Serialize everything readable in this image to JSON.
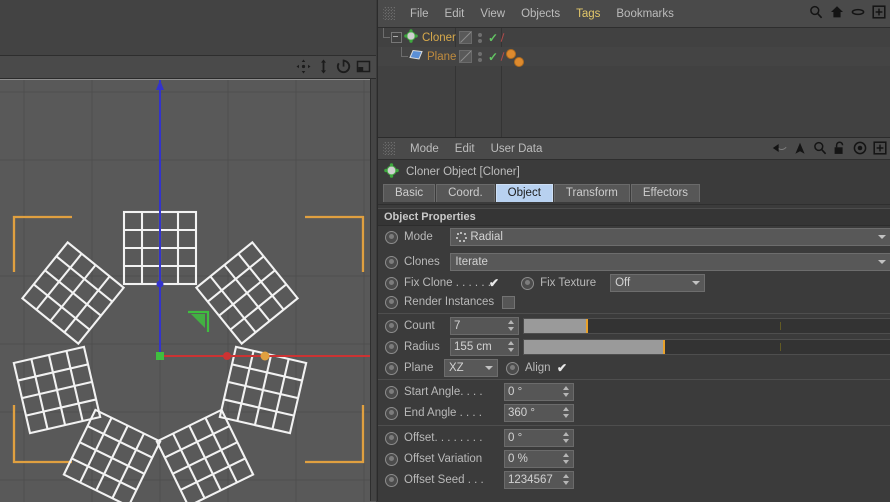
{
  "object_manager": {
    "menu": [
      {
        "label": "File",
        "highlight": false
      },
      {
        "label": "Edit",
        "highlight": false
      },
      {
        "label": "View",
        "highlight": false
      },
      {
        "label": "Objects",
        "highlight": false
      },
      {
        "label": "Tags",
        "highlight": true
      },
      {
        "label": "Bookmarks",
        "highlight": false
      }
    ],
    "icons": [
      "search-icon",
      "home-icon",
      "ellipse-icon",
      "add-box-icon"
    ],
    "tree": [
      {
        "name": "Cloner",
        "type": "cloner",
        "indent": 0,
        "tags": 0
      },
      {
        "name": "Plane",
        "type": "plane",
        "indent": 1,
        "tags": 2
      }
    ]
  },
  "attribute_manager": {
    "menu": [
      {
        "label": "Mode"
      },
      {
        "label": "Edit"
      },
      {
        "label": "User Data"
      }
    ],
    "icons": [
      "back-arrow-icon",
      "up-arrow-icon",
      "search-icon",
      "unlock-icon",
      "target-icon",
      "add-box-icon"
    ],
    "title": "Cloner Object [Cloner]",
    "tabs": [
      {
        "label": "Basic",
        "active": false
      },
      {
        "label": "Coord.",
        "active": false
      },
      {
        "label": "Object",
        "active": true
      },
      {
        "label": "Transform",
        "active": false
      },
      {
        "label": "Effectors",
        "active": false
      }
    ],
    "section_title": "Object Properties",
    "fields": {
      "mode_label": "Mode",
      "mode_value": "Radial",
      "clones_label": "Clones",
      "clones_value": "Iterate",
      "fix_clone_label": "Fix Clone . . . . . .",
      "fix_clone_checked": "✔",
      "fix_texture_label": "Fix Texture",
      "fix_texture_value": "Off",
      "render_instances_label": "Render Instances",
      "count_label": "Count",
      "count_value": "7",
      "count_fill_pct": 17,
      "radius_label": "Radius",
      "radius_value": "155 cm",
      "radius_fill_pct": 38,
      "plane_label": "Plane",
      "plane_value": "XZ",
      "align_label": "Align",
      "align_checked": "✔",
      "start_angle_label": "Start Angle. . . .",
      "start_angle_value": "0 °",
      "end_angle_label": "End Angle . . . .",
      "end_angle_value": "360 °",
      "offset_label": "Offset. . . . . . . .",
      "offset_value": "0 °",
      "offset_variation_label": "Offset Variation",
      "offset_variation_value": "0 %",
      "offset_seed_label": "Offset Seed . . .",
      "offset_seed_value": "1234567"
    }
  },
  "viewport": {
    "tools": [
      "move-camera-icon",
      "dolly-camera-icon",
      "rotate-camera-icon",
      "maximize-view-icon"
    ],
    "scene": {
      "clone_count": 7,
      "grid_subdivisions": 4,
      "axis_x_color": "#cc3333",
      "axis_y_color": "#3333cc",
      "origin_color": "#3fbf3f",
      "selection_bracket_color": "#e0a040",
      "wireframe_color": "#f2f2f2",
      "background_color": "#595959"
    }
  },
  "colors": {
    "accent": "#e8a12a",
    "tab_active": "#b8d1f0",
    "menu_highlight": "#e3c86a",
    "panel": "#3b3b3b"
  }
}
